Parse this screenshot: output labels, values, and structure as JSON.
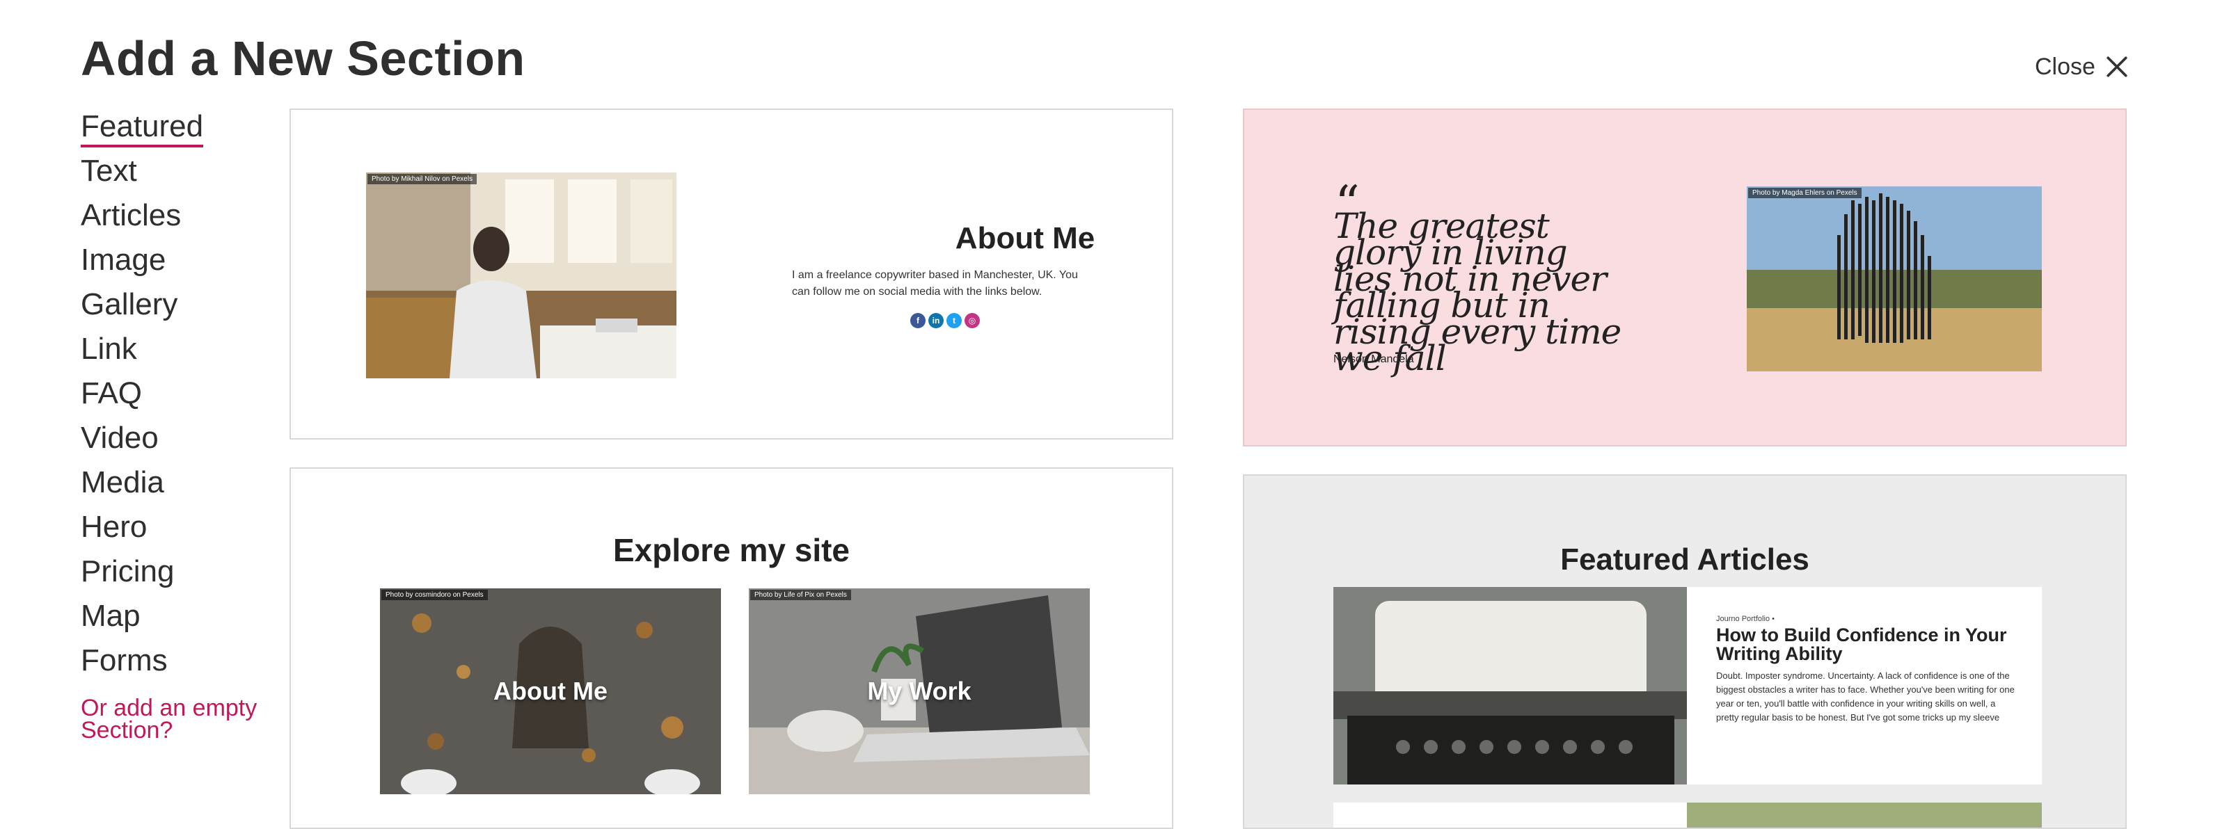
{
  "dialog": {
    "title": "Add a New Section",
    "close_label": "Close"
  },
  "sidebar": {
    "items": [
      {
        "label": "Featured"
      },
      {
        "label": "Text"
      },
      {
        "label": "Articles"
      },
      {
        "label": "Image"
      },
      {
        "label": "Gallery"
      },
      {
        "label": "Link"
      },
      {
        "label": "FAQ"
      },
      {
        "label": "Video"
      },
      {
        "label": "Media"
      },
      {
        "label": "Hero"
      },
      {
        "label": "Pricing"
      },
      {
        "label": "Map"
      },
      {
        "label": "Forms"
      }
    ],
    "active": "Featured",
    "empty_section_link": "Or add an empty Section?"
  },
  "templates": {
    "about": {
      "photo_credit": "Photo by Mikhail Nilov on Pexels",
      "heading": "About Me",
      "body": "I am a freelance copywriter based in Manchester, UK. You can follow me on social media with the links below.",
      "social_icons": [
        "facebook-icon",
        "linkedin-icon",
        "twitter-icon",
        "instagram-icon"
      ]
    },
    "quote": {
      "quote_text": "The greatest glory in living lies not in never falling but in rising every time we fall",
      "author": "Nelson Mandela",
      "photo_credit": "Photo by Magda Ehlers on Pexels"
    },
    "explore": {
      "heading": "Explore my site",
      "tiles": [
        {
          "label": "About Me",
          "photo_credit": "Photo by cosmindoro on Pexels"
        },
        {
          "label": "My Work",
          "photo_credit": "Photo by Life of Pix on Pexels"
        }
      ]
    },
    "articles": {
      "heading": "Featured Articles",
      "article_meta": "Journo Portfolio •",
      "article_title": "How to Build Confidence in Your Writing Ability",
      "article_body": "Doubt. Imposter syndrome. Uncertainty. A lack of confidence is one of the biggest obstacles a writer has to face. Whether you've been writing for one year or ten, you'll battle with confidence in your writing skills on well, a pretty regular basis to be honest. But I've got some tricks up my sleeve"
    }
  },
  "colors": {
    "accent": "#c2185b",
    "quote_card_bg": "#f9dde1",
    "articles_card_bg": "#ececec"
  }
}
